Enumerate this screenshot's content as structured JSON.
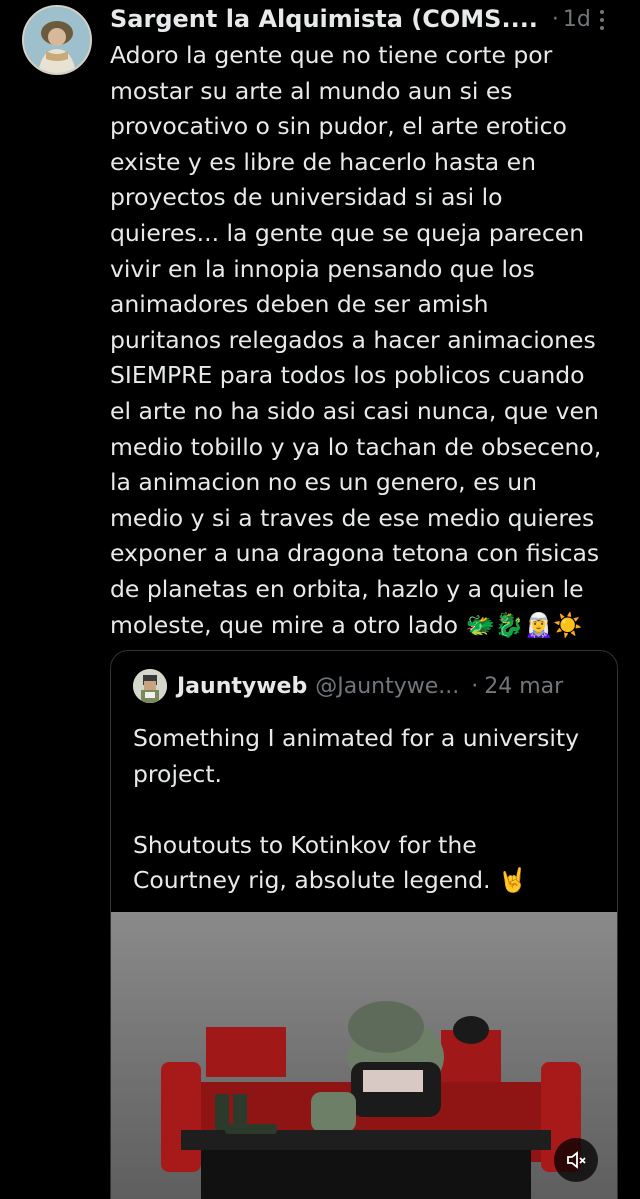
{
  "post": {
    "author": {
      "display_name": "Sargent la Alquimista (COMS....",
      "separator": "·",
      "time": "1d"
    },
    "text": "Adoro la gente que no tiene corte por\nmostar su arte al mundo aun si es\nprovocativo o sin pudor, el arte erotico\nexiste y es libre de hacerlo hasta en\nproyectos de universidad si asi lo\nquieres... la gente que se queja parecen\nvivir en la innopia pensando que los\nanimadores deben de ser amish\npuritanos relegados a hacer animaciones\nSIEMPRE para todos los poblicos cuando\nel arte no ha sido asi casi nunca, que ven\nmedio tobillo y ya lo tachan de obseceno,\nla animacion no es un genero, es un\nmedio y si a traves de ese medio quieres\nexponer a una dragona tetona con fisicas\nde planetas en orbita, hazlo y a quien le\nmoleste, que mire a otro lado 🐲🐉🧝‍♀️☀️"
  },
  "quote": {
    "author": {
      "display_name": "Jauntyweb",
      "handle": "@Jauntywe...",
      "separator": "·",
      "time": "24 mar"
    },
    "text": "Something I animated for a university\nproject.\n\nShoutouts to Kotinkov for the\nCourtney rig, absolute legend. 🤘",
    "media": {
      "type": "video",
      "mute_icon": "speaker-muted-icon"
    }
  },
  "icons": {
    "more": "more-vertical-icon",
    "avatar": "user-avatar",
    "quote_avatar": "quoted-user-avatar"
  },
  "colors": {
    "background": "#000000",
    "text": "#e7e9ea",
    "secondary": "#71767b",
    "border": "#2f3336"
  }
}
